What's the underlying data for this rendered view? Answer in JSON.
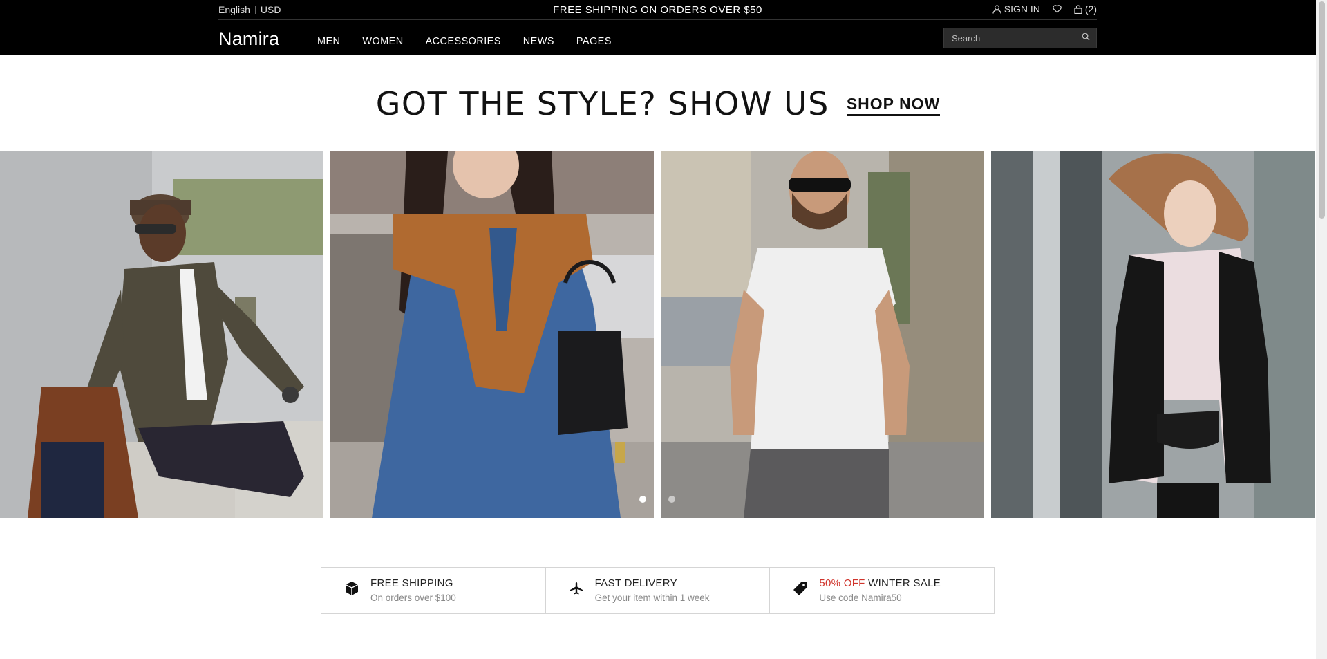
{
  "topbar": {
    "language": "English",
    "currency": "USD",
    "promo": "FREE SHIPPING ON ORDERS OVER $50",
    "sign_in": "SIGN IN",
    "cart_count": "(2)"
  },
  "nav": {
    "logo": "Namira",
    "links": [
      "MEN",
      "WOMEN",
      "ACCESSORIES",
      "NEWS",
      "PAGES"
    ],
    "search_placeholder": "Search"
  },
  "hero": {
    "heading": "GOT THE STYLE? SHOW US",
    "cta": "SHOP NOW"
  },
  "gallery": {
    "slides": 2,
    "active_slide": 1
  },
  "features": [
    {
      "title": "FREE SHIPPING",
      "title_highlight": "",
      "subtitle": "On orders over $100",
      "icon": "box-icon"
    },
    {
      "title": "FAST DELIVERY",
      "title_highlight": "",
      "subtitle": "Get your item within 1 week",
      "icon": "airplane-icon"
    },
    {
      "title": " WINTER SALE",
      "title_highlight": "50% OFF",
      "subtitle": "Use code Namira50",
      "icon": "tag-icon"
    }
  ],
  "colors": {
    "header_bg": "#000000",
    "accent_red": "#d0342c"
  }
}
